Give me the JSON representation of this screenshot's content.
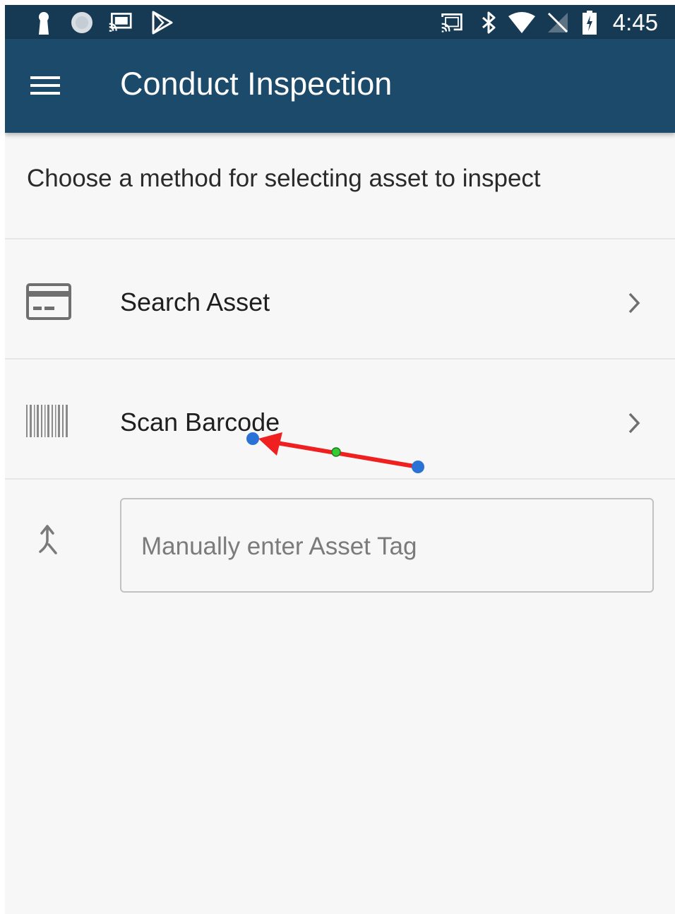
{
  "status_bar": {
    "time": "4:45",
    "left_icons": [
      "keyhole-icon",
      "circle-app-icon",
      "cast-screen-icon",
      "play-store-icon"
    ],
    "right_icons": [
      "cast-icon",
      "bluetooth-icon",
      "wifi-icon",
      "no-signal-icon",
      "battery-charging-icon"
    ]
  },
  "app_bar": {
    "title": "Conduct Inspection",
    "menu_icon": "hamburger-menu-icon",
    "color": "#1c4a6b"
  },
  "main": {
    "prompt": "Choose a method for selecting asset to inspect",
    "options": [
      {
        "label": "Search Asset",
        "icon": "card-icon"
      },
      {
        "label": "Scan Barcode",
        "icon": "barcode-icon"
      }
    ],
    "manual_entry": {
      "placeholder": "Manually enter Asset Tag",
      "value": "",
      "icon": "merge-arrow-icon"
    }
  },
  "annotation": {
    "type": "arrow",
    "color": "#f02020",
    "endpoint_color": "#2a73d6",
    "midpoint_color": "#33cc33"
  }
}
